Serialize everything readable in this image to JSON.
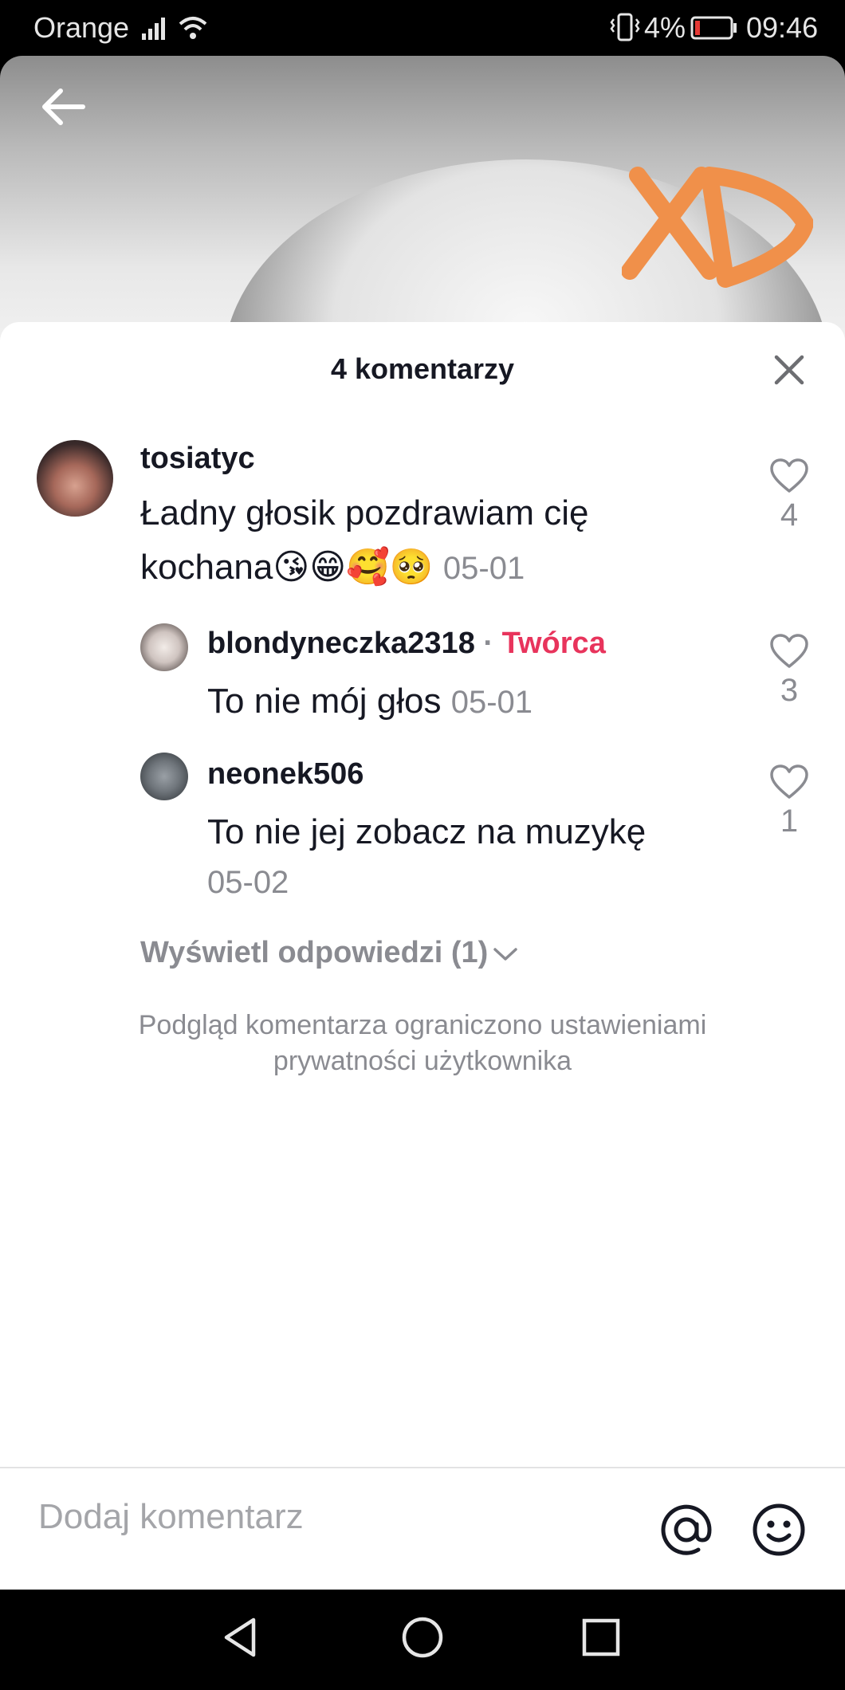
{
  "status_bar": {
    "carrier": "Orange",
    "battery_percent": "4%",
    "time": "09:46"
  },
  "video": {
    "overlay_text": "XD"
  },
  "comments_panel": {
    "title": "4 komentarzy",
    "comments": [
      {
        "username": "tosiatyc",
        "text_line1": "Ładny głosik pozdrawiam cię",
        "text_line2": "kochana😘😁🥰🥺",
        "date": "05-01",
        "likes": "4"
      }
    ],
    "replies": [
      {
        "username": "blondyneczka2318",
        "separator": "·",
        "badge": "Twórca",
        "text": "To nie mój głos",
        "date": "05-01",
        "likes": "3"
      },
      {
        "username": "neonek506",
        "text": "To nie jej zobacz na muzykę",
        "date": "05-02",
        "likes": "1"
      }
    ],
    "view_replies": "Wyświetl odpowiedzi (1)",
    "privacy_line1": "Podgląd komentarza ograniczono ustawieniami",
    "privacy_line2": "prywatności użytkownika"
  },
  "composer": {
    "placeholder": "Dodaj komentarz"
  },
  "colors": {
    "creator_badge": "#e8345c",
    "overlay_text": "#f0904a",
    "muted": "#8a8b91"
  },
  "icons": [
    "back-arrow-icon",
    "close-icon",
    "heart-icon",
    "chevron-down-icon",
    "at-icon",
    "emoji-icon",
    "nav-back-icon",
    "nav-home-icon",
    "nav-recents-icon"
  ]
}
